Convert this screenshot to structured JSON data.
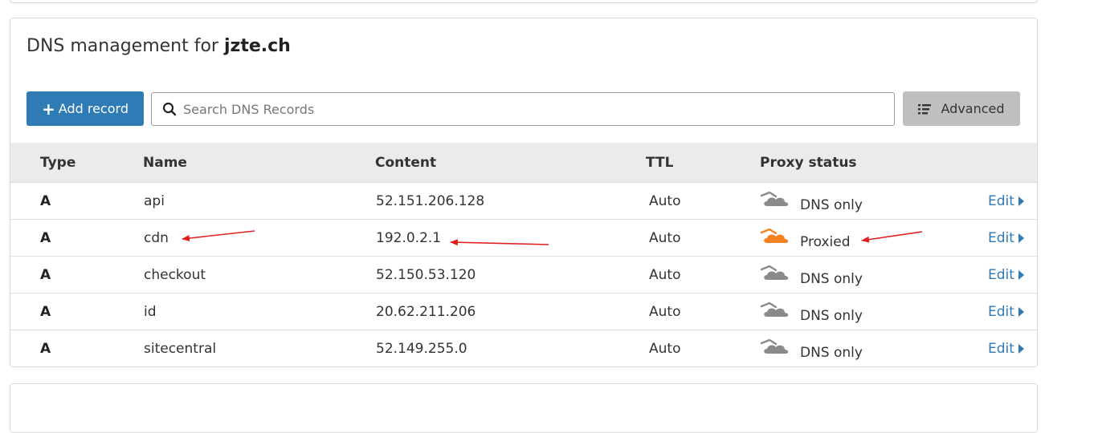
{
  "header": {
    "title_prefix": "DNS management for",
    "domain": "jzte.ch"
  },
  "toolbar": {
    "add_label": "Add record",
    "search_placeholder": "Search DNS Records",
    "advanced_label": "Advanced"
  },
  "table": {
    "columns": [
      "Type",
      "Name",
      "Content",
      "TTL",
      "Proxy status"
    ],
    "rows": [
      {
        "type": "A",
        "name": "api",
        "content": "52.151.206.128",
        "ttl": "Auto",
        "proxy": "DNS only",
        "proxied": false,
        "edit": "Edit"
      },
      {
        "type": "A",
        "name": "cdn",
        "content": "192.0.2.1",
        "ttl": "Auto",
        "proxy": "Proxied",
        "proxied": true,
        "edit": "Edit"
      },
      {
        "type": "A",
        "name": "checkout",
        "content": "52.150.53.120",
        "ttl": "Auto",
        "proxy": "DNS only",
        "proxied": false,
        "edit": "Edit"
      },
      {
        "type": "A",
        "name": "id",
        "content": "20.62.211.206",
        "ttl": "Auto",
        "proxy": "DNS only",
        "proxied": false,
        "edit": "Edit"
      },
      {
        "type": "A",
        "name": "sitecentral",
        "content": "52.149.255.0",
        "ttl": "Auto",
        "proxy": "DNS only",
        "proxied": false,
        "edit": "Edit"
      }
    ]
  },
  "colors": {
    "accent": "#2f7bb6",
    "proxied_cloud": "#f6821f",
    "dns_only_cloud": "#8a8a8a",
    "annotation_arrow": "#e02020"
  },
  "icons": {
    "search": "search-icon",
    "advanced": "list-icon",
    "proxied": "cloud-orange-icon",
    "dns_only": "cloud-gray-icon",
    "edit": "caret-right-icon"
  }
}
